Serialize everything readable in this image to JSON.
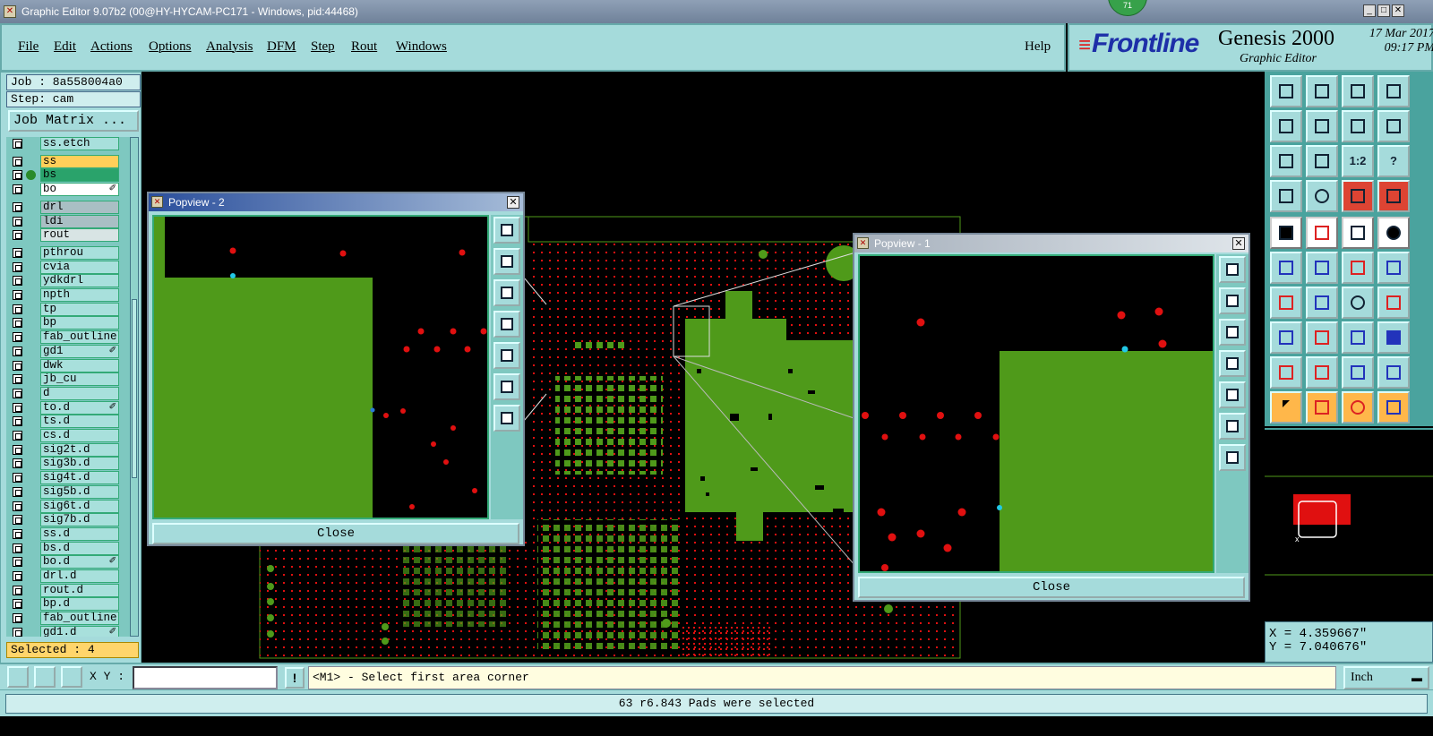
{
  "window": {
    "title": "Graphic Editor 9.07b2 (00@HY-HYCAM-PC171 - Windows, pid:44468)",
    "badge": "71",
    "controls": [
      "_",
      "□",
      "✕"
    ]
  },
  "menu": {
    "items": [
      "File",
      "Edit",
      "Actions",
      "Options",
      "Analysis",
      "DFM",
      "Step",
      "Rout",
      "Windows"
    ],
    "help": "Help"
  },
  "brand": {
    "logo": "Frontline",
    "product": "Genesis 2000",
    "subtitle": "Graphic Editor",
    "date": "17 Mar 2017",
    "time": "09:17 PM"
  },
  "left": {
    "job": "Job : 8a558004a0",
    "step": "Step: cam",
    "job_matrix": "Job Matrix ...",
    "layers": [
      {
        "name": "ss.etch",
        "bg": "#a8e0dc"
      },
      {
        "name": "ss",
        "bg": "#ffcf5a"
      },
      {
        "name": "bs",
        "bg": "#2aa36b",
        "dot": true
      },
      {
        "name": "bo",
        "bg": "#ffffff",
        "mark": "✐"
      },
      {
        "name": "drl",
        "bg": "#a9bfc4"
      },
      {
        "name": "ldi",
        "bg": "#a9bfc4"
      },
      {
        "name": "rout",
        "bg": "#d8e4e4"
      },
      {
        "name": "pthrou",
        "bg": "#a8e0dc"
      },
      {
        "name": "cvia",
        "bg": "#a8e0dc"
      },
      {
        "name": "ydkdrl",
        "bg": "#a8e0dc"
      },
      {
        "name": "npth",
        "bg": "#a8e0dc"
      },
      {
        "name": "tp",
        "bg": "#a8e0dc"
      },
      {
        "name": "bp",
        "bg": "#a8e0dc"
      },
      {
        "name": "fab_outline",
        "bg": "#a8e0dc"
      },
      {
        "name": "gd1",
        "bg": "#a8e0dc",
        "mark": "✐"
      },
      {
        "name": "dwk",
        "bg": "#a8e0dc"
      },
      {
        "name": "jb_cu",
        "bg": "#a8e0dc"
      },
      {
        "name": "d",
        "bg": "#a8e0dc"
      },
      {
        "name": "to.d",
        "bg": "#a8e0dc",
        "mark": "✐"
      },
      {
        "name": "ts.d",
        "bg": "#a8e0dc"
      },
      {
        "name": "cs.d",
        "bg": "#a8e0dc"
      },
      {
        "name": "sig2t.d",
        "bg": "#a8e0dc"
      },
      {
        "name": "sig3b.d",
        "bg": "#a8e0dc"
      },
      {
        "name": "sig4t.d",
        "bg": "#a8e0dc"
      },
      {
        "name": "sig5b.d",
        "bg": "#a8e0dc"
      },
      {
        "name": "sig6t.d",
        "bg": "#a8e0dc"
      },
      {
        "name": "sig7b.d",
        "bg": "#a8e0dc"
      },
      {
        "name": "ss.d",
        "bg": "#a8e0dc"
      },
      {
        "name": "bs.d",
        "bg": "#a8e0dc"
      },
      {
        "name": "bo.d",
        "bg": "#a8e0dc",
        "mark": "✐"
      },
      {
        "name": "drl.d",
        "bg": "#a8e0dc"
      },
      {
        "name": "rout.d",
        "bg": "#a8e0dc"
      },
      {
        "name": "bp.d",
        "bg": "#a8e0dc"
      },
      {
        "name": "fab_outline",
        "bg": "#a8e0dc"
      },
      {
        "name": "gd1.d",
        "bg": "#a8e0dc",
        "mark": "✐"
      }
    ],
    "selected": "Selected : 4"
  },
  "popview2": {
    "title": "Popview - 2",
    "close_label": "Close"
  },
  "popview1": {
    "title": "Popview - 1",
    "close_label": "Close"
  },
  "toolbox": {
    "ratio_label": "1:2",
    "help_label": "?"
  },
  "coords": {
    "x": "X = 4.359667\"",
    "y": "Y = 7.040676\""
  },
  "bottom": {
    "xy_label": "X Y :",
    "xy_value": "",
    "warn_label": "!",
    "prompt": "<M1> - Select first area corner",
    "units": "Inch"
  },
  "status": {
    "message": "63 r6.843 Pads were selected"
  },
  "colors": {
    "panel": "#a5dbdb",
    "copper": "#4f9a1a",
    "pad": "#e01010",
    "highlight": "#22c8e6"
  }
}
